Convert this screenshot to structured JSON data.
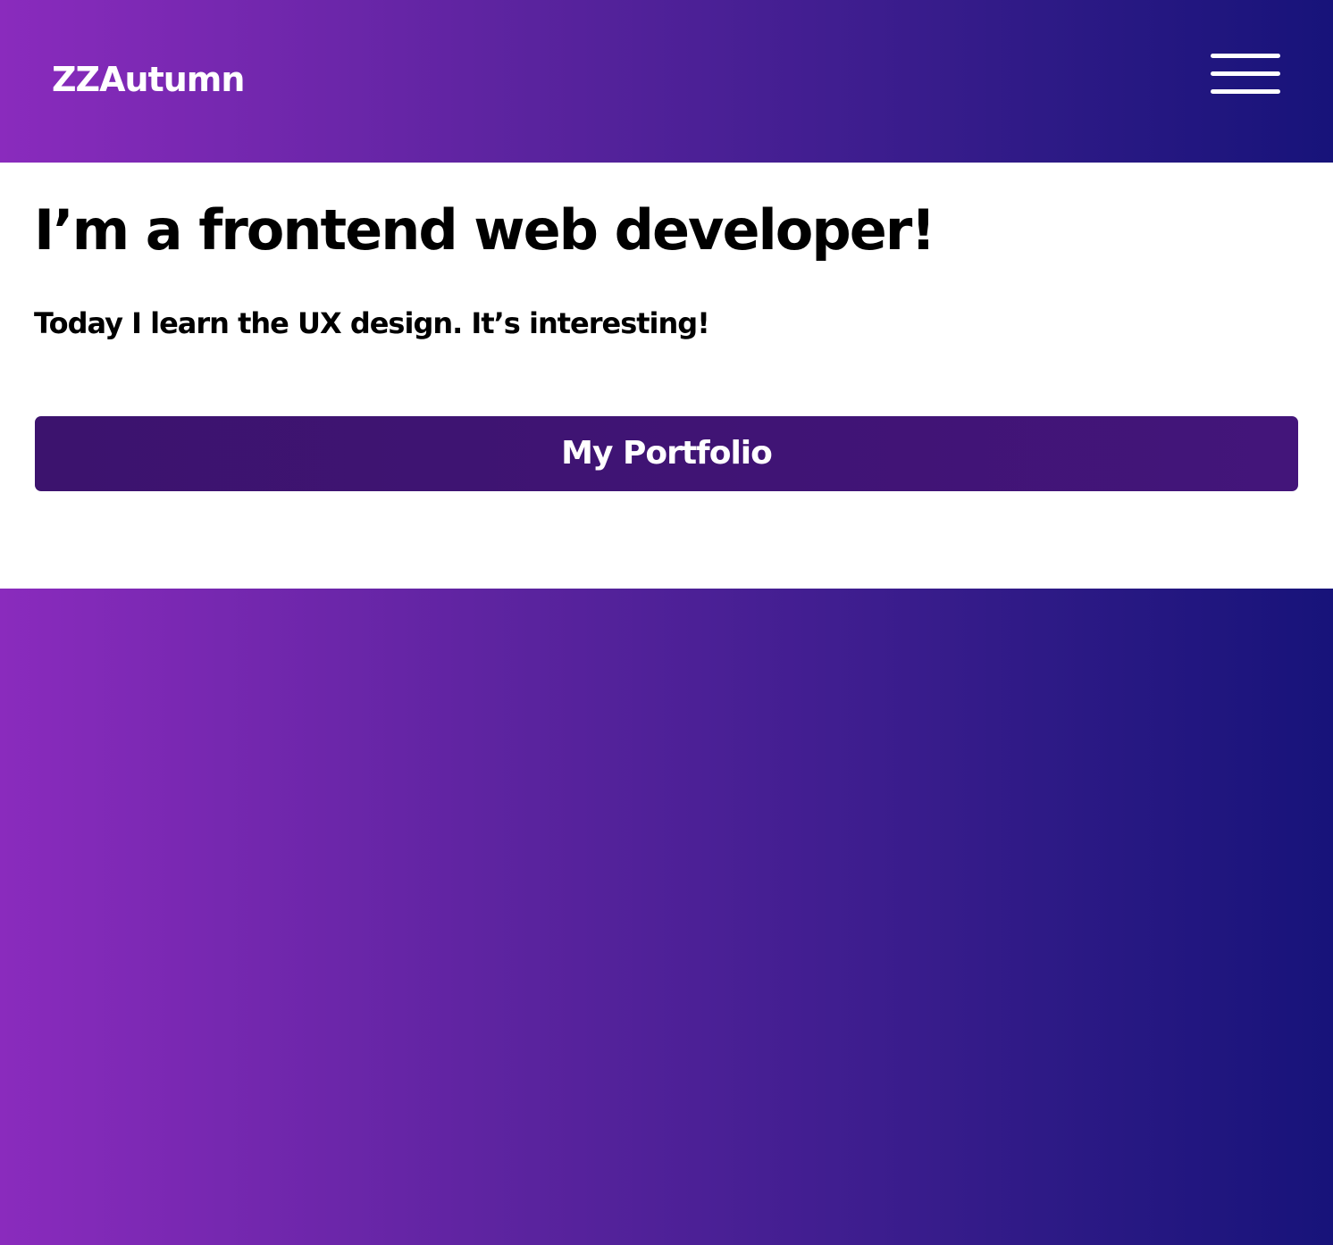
{
  "header": {
    "logo_text": "ZZAutumn",
    "menu_icon": "hamburger-menu-icon"
  },
  "hero": {
    "headline": "I’m a frontend web developer!",
    "subtext": "Today I learn the UX design. It’s interesting!",
    "cta_label": "My Portfolio"
  },
  "colors": {
    "gradient_start": "#8a2bbd",
    "gradient_end": "#17137a",
    "button_bg": "#3c136e",
    "text_dark": "#000000",
    "text_light": "#ffffff"
  }
}
